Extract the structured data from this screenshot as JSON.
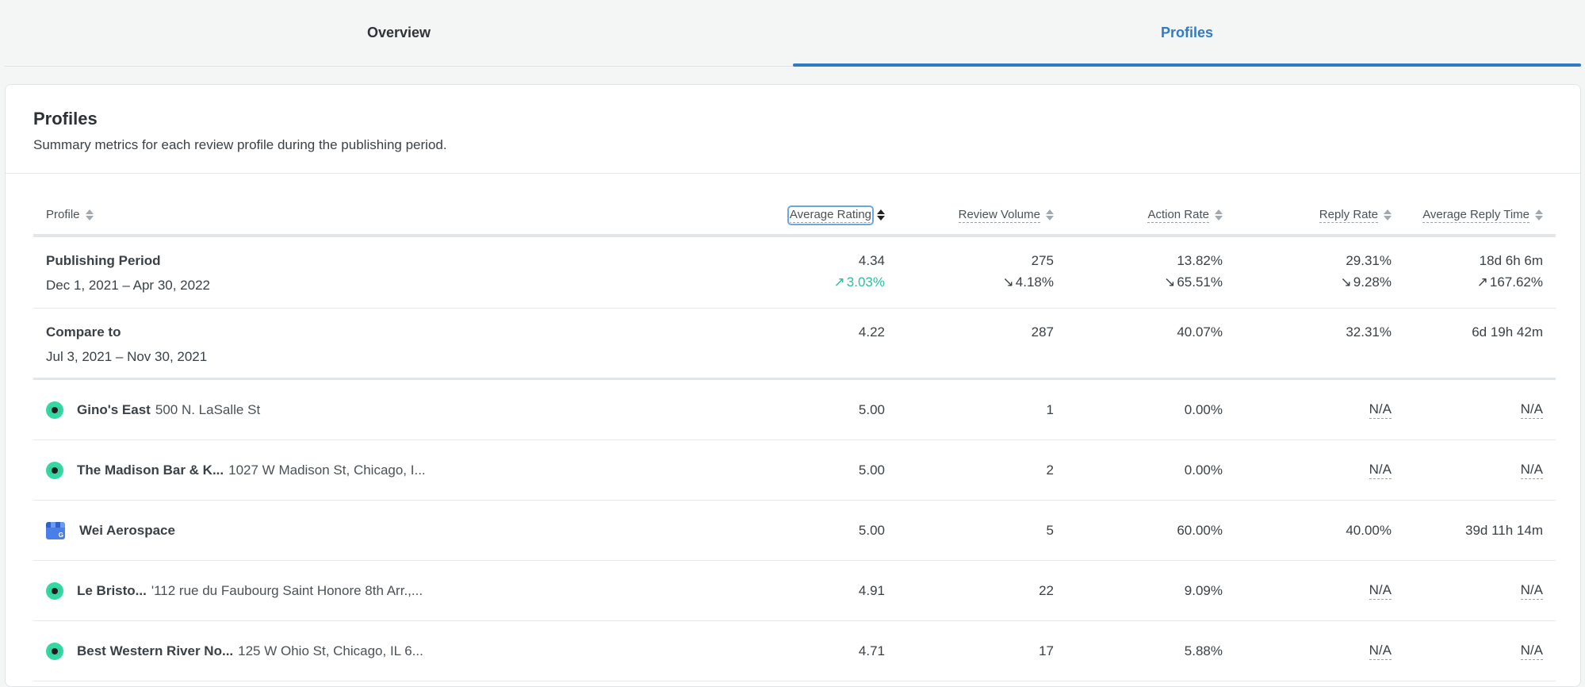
{
  "tabs": [
    {
      "label": "Overview",
      "active": false
    },
    {
      "label": "Profiles",
      "active": true
    }
  ],
  "card": {
    "title": "Profiles",
    "subtitle": "Summary metrics for each review profile during the publishing period."
  },
  "columns": {
    "profile": "Profile",
    "average_rating": "Average Rating",
    "review_volume": "Review Volume",
    "action_rate": "Action Rate",
    "reply_rate": "Reply Rate",
    "average_reply_time": "Average Reply Time"
  },
  "publishing_period": {
    "title": "Publishing Period",
    "dates": "Dec 1, 2021 – Apr 30, 2022",
    "average_rating": "4.34",
    "average_rating_delta": "3.03%",
    "review_volume": "275",
    "review_volume_delta": "4.18%",
    "action_rate": "13.82%",
    "action_rate_delta": "65.51%",
    "reply_rate": "29.31%",
    "reply_rate_delta": "9.28%",
    "average_reply_time": "18d 6h 6m",
    "average_reply_time_delta": "167.62%"
  },
  "compare_to": {
    "title": "Compare to",
    "dates": "Jul 3, 2021 – Nov 30, 2021",
    "average_rating": "4.22",
    "review_volume": "287",
    "action_rate": "40.07%",
    "reply_rate": "32.31%",
    "average_reply_time": "6d 19h 42m"
  },
  "profiles": [
    {
      "name": "Gino's East",
      "address": "500 N. LaSalle St",
      "icon": "tripadvisor-icon",
      "average_rating": "5.00",
      "review_volume": "1",
      "action_rate": "0.00%",
      "reply_rate": "N/A",
      "average_reply_time": "N/A"
    },
    {
      "name": "The Madison Bar & K...",
      "address": "1027 W Madison St, Chicago, I...",
      "icon": "tripadvisor-icon",
      "average_rating": "5.00",
      "review_volume": "2",
      "action_rate": "0.00%",
      "reply_rate": "N/A",
      "average_reply_time": "N/A"
    },
    {
      "name": "Wei Aerospace",
      "address": "",
      "icon": "google-my-business-icon",
      "average_rating": "5.00",
      "review_volume": "5",
      "action_rate": "60.00%",
      "reply_rate": "40.00%",
      "average_reply_time": "39d 11h 14m"
    },
    {
      "name": "Le Bristo...",
      "address": "'112 rue du Faubourg Saint Honore 8th Arr.,...",
      "icon": "tripadvisor-icon",
      "average_rating": "4.91",
      "review_volume": "22",
      "action_rate": "9.09%",
      "reply_rate": "N/A",
      "average_reply_time": "N/A"
    },
    {
      "name": "Best Western River No...",
      "address": "125 W Ohio St, Chicago, IL 6...",
      "icon": "tripadvisor-icon",
      "average_rating": "4.71",
      "review_volume": "17",
      "action_rate": "5.88%",
      "reply_rate": "N/A",
      "average_reply_time": "N/A"
    }
  ],
  "colors": {
    "accent": "#2f7cc4",
    "positive": "#2bbf9f",
    "tripadvisor": "#35d7a2"
  }
}
